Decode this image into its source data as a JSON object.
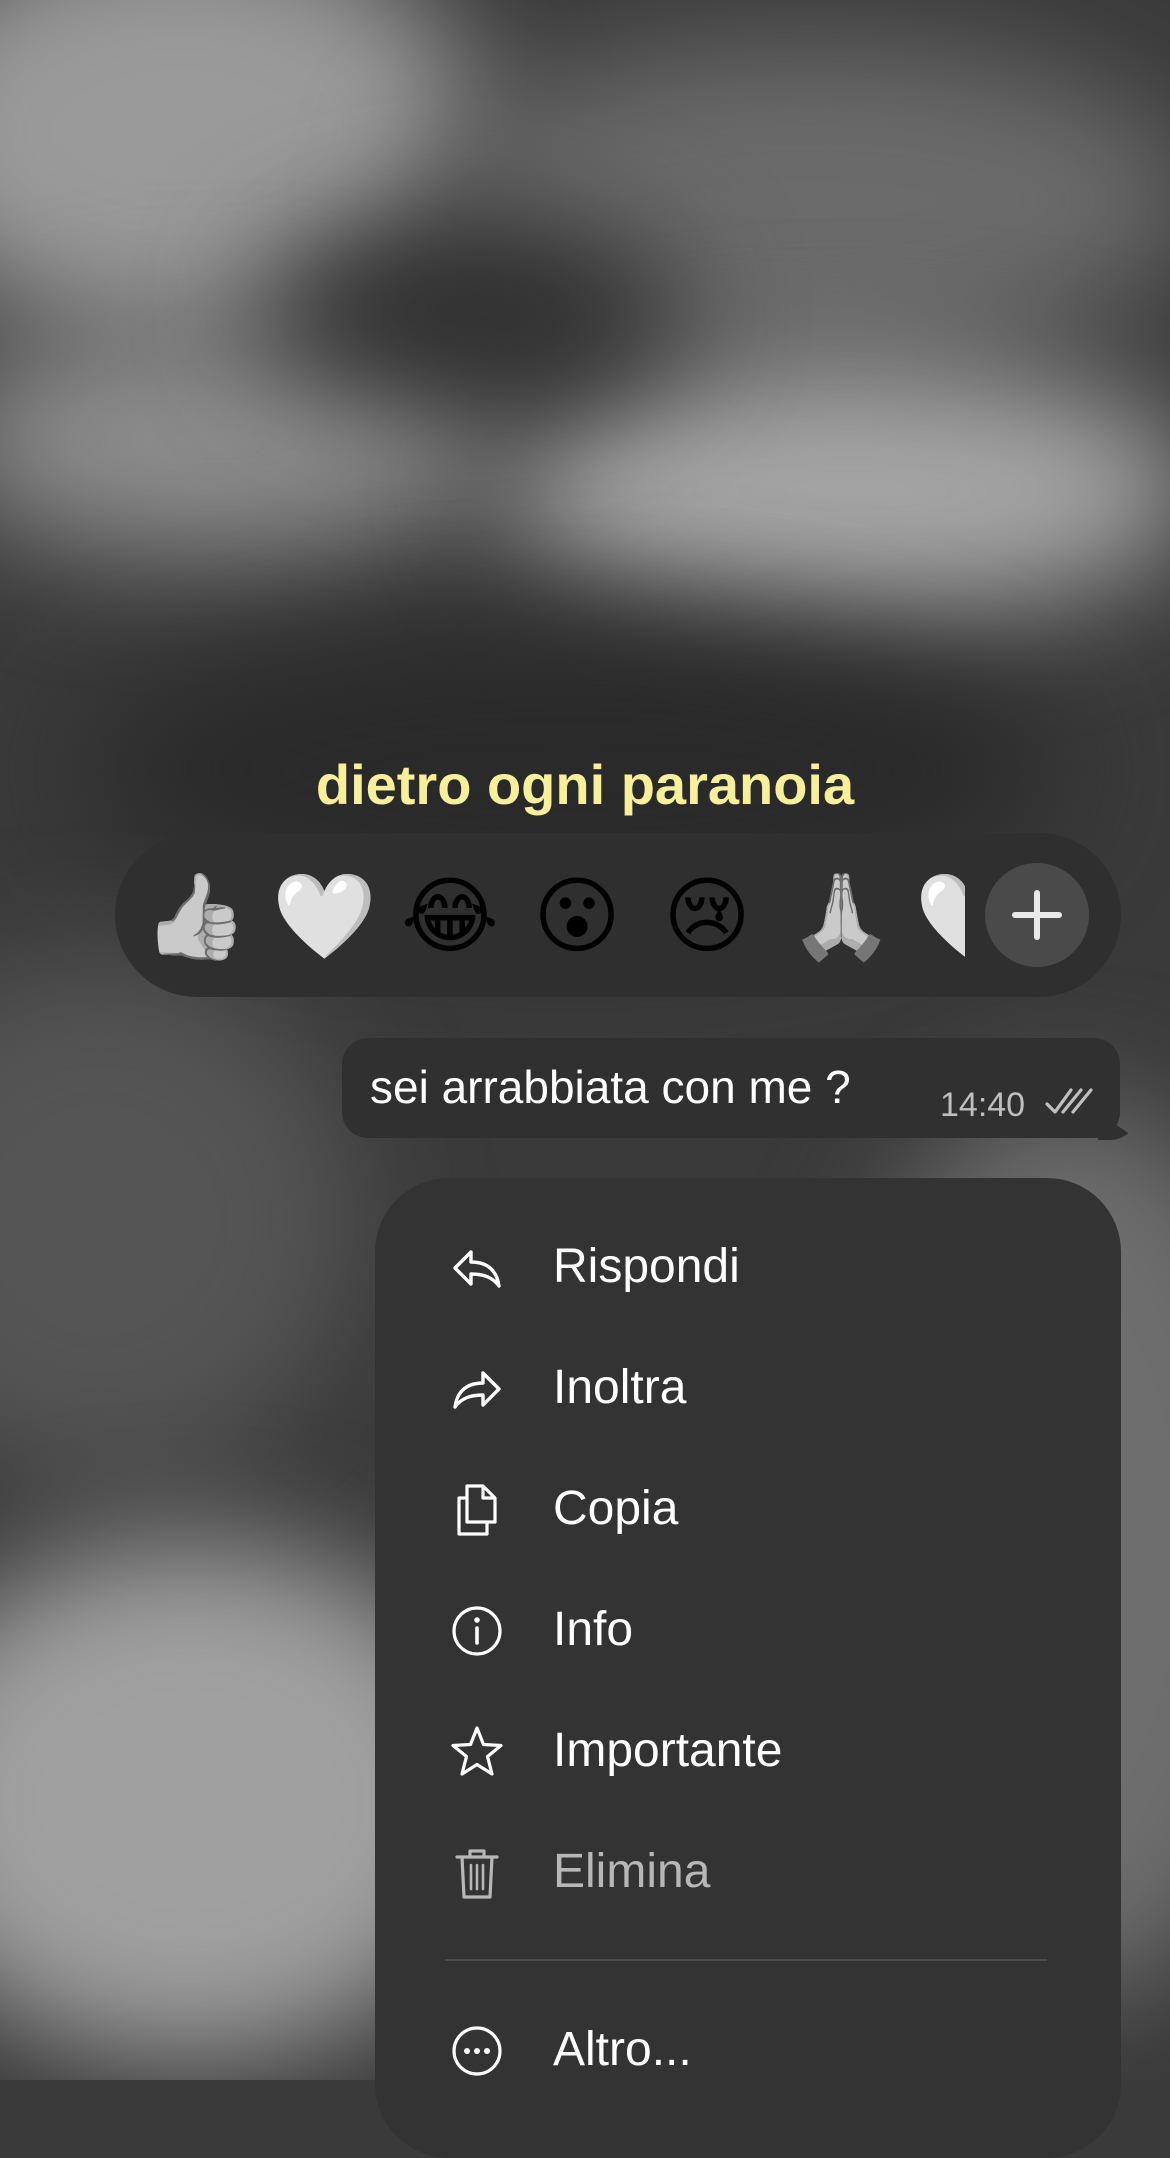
{
  "caption": "dietro ogni paranoia",
  "reactions": {
    "items": [
      {
        "icon": "thumbs-up-icon",
        "glyph": "👍"
      },
      {
        "icon": "heart-icon",
        "glyph": "🤍"
      },
      {
        "icon": "laughing-icon",
        "glyph": "😂"
      },
      {
        "icon": "surprised-icon",
        "glyph": "😮"
      },
      {
        "icon": "crying-icon",
        "glyph": "😢"
      },
      {
        "icon": "praying-hands-icon",
        "glyph": "🙏"
      },
      {
        "icon": "partial-heart-icon",
        "glyph": "🤍"
      }
    ],
    "more_icon": "plus-icon"
  },
  "message": {
    "text": "sei arrabbiata con me ?",
    "time": "14:40",
    "status_icon": "double-check-icon"
  },
  "menu": {
    "items": [
      {
        "label": "Rispondi",
        "icon": "reply-icon"
      },
      {
        "label": "Inoltra",
        "icon": "forward-icon"
      },
      {
        "label": "Copia",
        "icon": "copy-icon"
      },
      {
        "label": "Info",
        "icon": "info-icon"
      },
      {
        "label": "Importante",
        "icon": "star-icon"
      },
      {
        "label": "Elimina",
        "icon": "trash-icon"
      },
      {
        "label": "Altro...",
        "icon": "more-icon"
      }
    ]
  },
  "colors": {
    "caption": "#f7ef9a",
    "panel": "#333333",
    "text": "#ffffff",
    "muted": "#b7b7b7"
  }
}
